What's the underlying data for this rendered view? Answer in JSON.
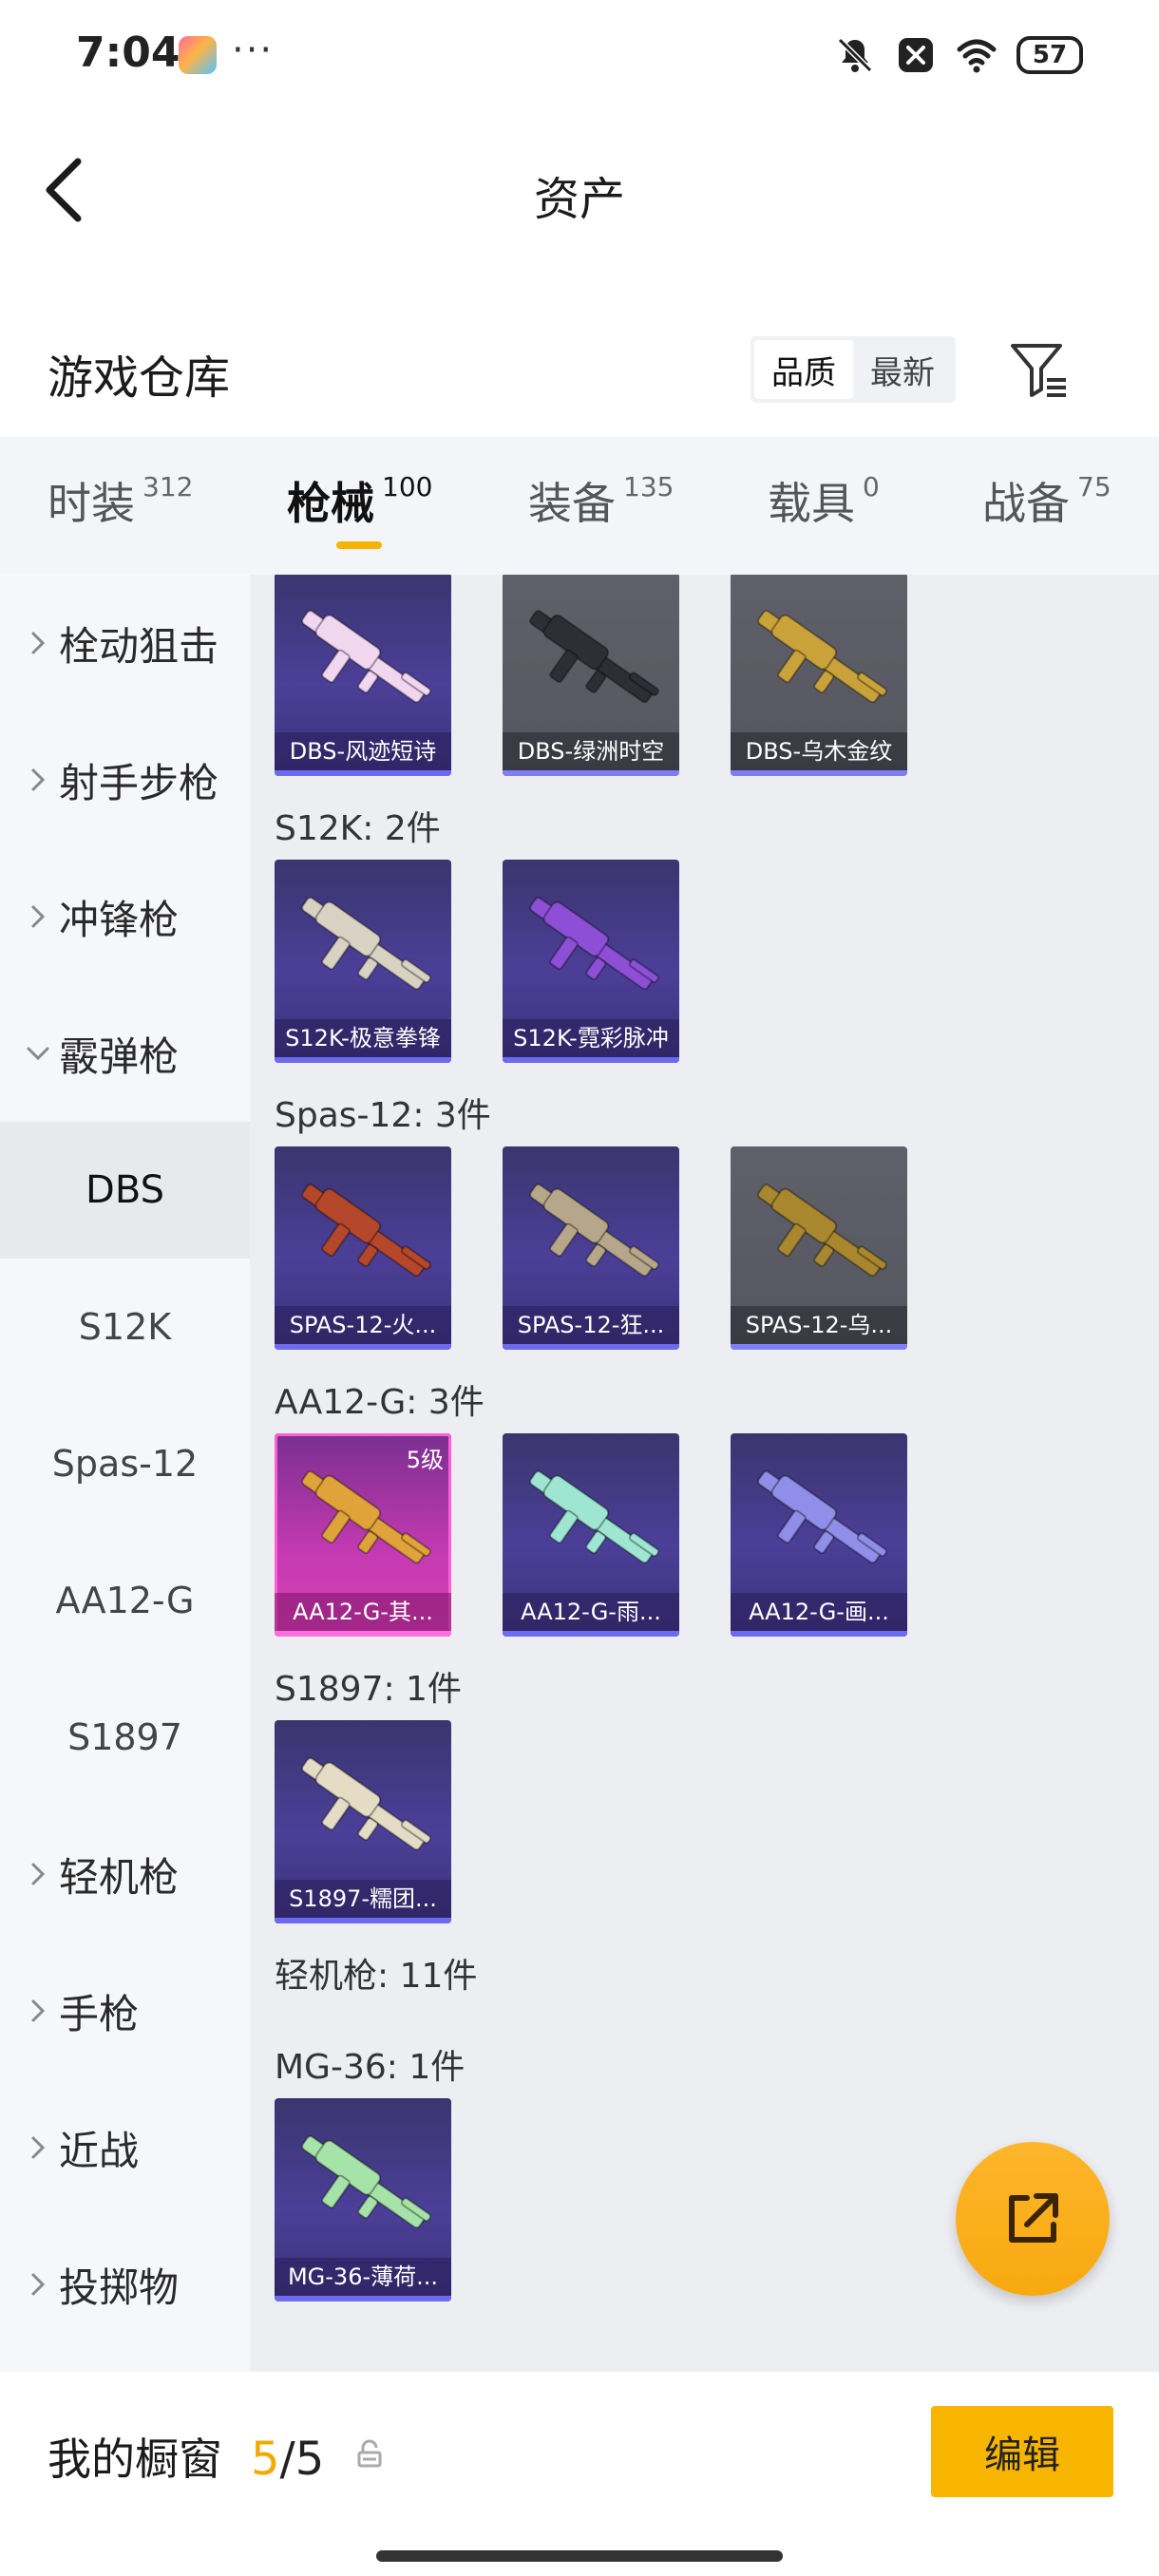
{
  "status_bar": {
    "time": "7:04",
    "dots": "···",
    "battery": "57"
  },
  "header": {
    "title": "资产"
  },
  "warehouse": {
    "title": "游戏仓库",
    "sort_options": [
      "品质",
      "最新"
    ],
    "active_sort": "品质"
  },
  "tabs": [
    {
      "label": "时装",
      "count": "312"
    },
    {
      "label": "枪械",
      "count": "100"
    },
    {
      "label": "装备",
      "count": "135"
    },
    {
      "label": "载具",
      "count": "0"
    },
    {
      "label": "战备",
      "count": "75"
    }
  ],
  "active_tab": "枪械",
  "sidebar": {
    "items": [
      {
        "label": "栓动狙击",
        "type": "category",
        "expanded": false
      },
      {
        "label": "射手步枪",
        "type": "category",
        "expanded": false
      },
      {
        "label": "冲锋枪",
        "type": "category",
        "expanded": false
      },
      {
        "label": "霰弹枪",
        "type": "category",
        "expanded": true
      },
      {
        "label": "DBS",
        "type": "sub",
        "selected": true
      },
      {
        "label": "S12K",
        "type": "sub"
      },
      {
        "label": "Spas-12",
        "type": "sub"
      },
      {
        "label": "AA12-G",
        "type": "sub"
      },
      {
        "label": "S1897",
        "type": "sub"
      },
      {
        "label": "轻机枪",
        "type": "category",
        "expanded": false
      },
      {
        "label": "手枪",
        "type": "category",
        "expanded": false
      },
      {
        "label": "近战",
        "type": "category",
        "expanded": false
      },
      {
        "label": "投掷物",
        "type": "category",
        "expanded": false
      }
    ]
  },
  "groups": [
    {
      "title": "",
      "cards": [
        {
          "label": "DBS-风迹短诗",
          "style": "purple",
          "weapon_color": "#f1d6f0"
        },
        {
          "label": "DBS-绿洲时空",
          "style": "gray",
          "weapon_color": "#2c2f36"
        },
        {
          "label": "DBS-乌木金纹",
          "style": "gray",
          "weapon_color": "#c9a23a"
        }
      ]
    },
    {
      "title": "S12K: 2件",
      "cards": [
        {
          "label": "S12K-极意拳锋",
          "style": "purple",
          "weapon_color": "#d9d2c3"
        },
        {
          "label": "S12K-霓彩脉冲",
          "style": "purple",
          "weapon_color": "#8c4fd6"
        }
      ]
    },
    {
      "title": "Spas-12: 3件",
      "cards": [
        {
          "label": "SPAS-12-火...",
          "style": "purple",
          "weapon_color": "#b5472b"
        },
        {
          "label": "SPAS-12-狂...",
          "style": "purple",
          "weapon_color": "#b7a78a"
        },
        {
          "label": "SPAS-12-乌...",
          "style": "gray",
          "weapon_color": "#a8872f"
        }
      ]
    },
    {
      "title": "AA12-G: 3件",
      "cards": [
        {
          "label": "AA12-G-其...",
          "style": "pink",
          "level": "5级",
          "weapon_color": "#e0a33a"
        },
        {
          "label": "AA12-G-雨...",
          "style": "purple",
          "weapon_color": "#9ee6d2"
        },
        {
          "label": "AA12-G-画...",
          "style": "purple",
          "weapon_color": "#8f8ee8"
        }
      ]
    },
    {
      "title": "S1897: 1件",
      "cards": [
        {
          "label": "S1897-糯团...",
          "style": "purple",
          "weapon_color": "#e4dcc4"
        }
      ]
    },
    {
      "title": "轻机枪: 11件",
      "cards": []
    },
    {
      "title": "MG-36: 1件",
      "cards": [
        {
          "label": "MG-36-薄荷...",
          "style": "purple",
          "weapon_color": "#a6e3a8"
        }
      ]
    }
  ],
  "bottom_bar": {
    "title": "我的橱窗",
    "count_current": "5",
    "count_sep": "/",
    "count_max": "5",
    "edit_label": "编辑"
  },
  "colors": {
    "accent": "#F7B500",
    "count_highlight": "#F2A900",
    "card_purple": "#4B3F98",
    "card_gray": "#5F6069",
    "card_pink": "#C53AB2"
  }
}
